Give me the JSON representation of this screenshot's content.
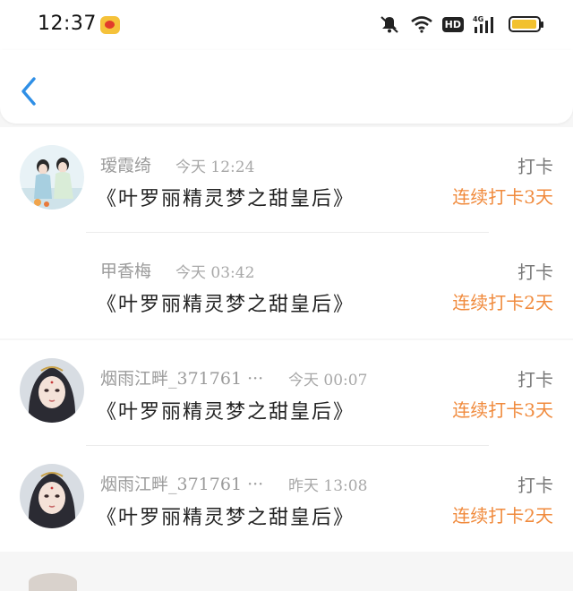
{
  "status_bar": {
    "time": "12:37",
    "hd_label": "HD",
    "network_label": "4G",
    "battery_level": 0.95,
    "icons": [
      "weibo-icon",
      "mute-icon",
      "wifi-icon",
      "hd-icon",
      "signal-icon",
      "battery-icon"
    ]
  },
  "nav": {
    "back_icon": "chevron-left-icon",
    "accent_color": "#2f8fe6"
  },
  "records": [
    {
      "username": "瑷霞绮",
      "timestamp": "今天 12:24",
      "book": "《叶罗丽精灵梦之甜皇后》",
      "action": "打卡",
      "streak": "连续打卡3天",
      "has_avatar": true
    },
    {
      "username": "甲香梅",
      "timestamp": "今天 03:42",
      "book": "《叶罗丽精灵梦之甜皇后》",
      "action": "打卡",
      "streak": "连续打卡2天",
      "has_avatar": false
    },
    {
      "username": "烟雨江畔_371761 ···",
      "timestamp": "今天 00:07",
      "book": "《叶罗丽精灵梦之甜皇后》",
      "action": "打卡",
      "streak": "连续打卡3天",
      "has_avatar": true
    },
    {
      "username": "烟雨江畔_371761 ···",
      "timestamp": "昨天 13:08",
      "book": "《叶罗丽精灵梦之甜皇后》",
      "action": "打卡",
      "streak": "连续打卡2天",
      "has_avatar": true
    }
  ],
  "colors": {
    "streak": "#f08a3c",
    "secondary_text": "#9b9b9b",
    "primary_text": "#222222",
    "background": "#f6f6f6"
  }
}
